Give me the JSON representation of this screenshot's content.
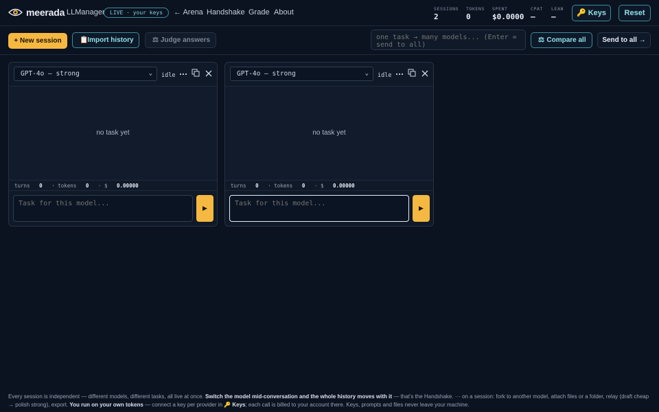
{
  "header": {
    "brand": "meerada",
    "app_name": "LLManager",
    "live_badge": "LIVE · your keys",
    "nav": [
      "← Arena",
      "Handshake",
      "Grade",
      "About"
    ],
    "stats": [
      {
        "label": "SESSIONS",
        "value": "2"
      },
      {
        "label": "TOKENS",
        "value": "0"
      },
      {
        "label": "SPENT",
        "value": "$0.0000"
      },
      {
        "label": "CPAT",
        "value": "—"
      },
      {
        "label": "LEAN",
        "value": "—"
      }
    ],
    "keys_label": "🔑 Keys",
    "reset_label": "Reset"
  },
  "toolbar": {
    "new_session": "+ New session",
    "import_history": "Import history",
    "judge_answers": "Judge answers",
    "broadcast_placeholder": "one task → many models... (Enter = send to all)",
    "compare_all": "Compare all",
    "send_to_all": "Send to all →"
  },
  "sessions": [
    {
      "model": "GPT-4o — strong",
      "state": "idle",
      "empty_text": "no task yet",
      "turns_label": "turns",
      "turns": "0",
      "tokens_label": "· tokens",
      "tokens": "0",
      "cost_label": "· $",
      "cost": "0.00000",
      "input_placeholder": "Task for this model...",
      "run_label": "▶"
    },
    {
      "model": "GPT-4o — strong",
      "state": "idle",
      "empty_text": "no task yet",
      "turns_label": "turns",
      "turns": "0",
      "tokens_label": "· tokens",
      "tokens": "0",
      "cost_label": "· $",
      "cost": "0.00000",
      "input_placeholder": "Task for this model...",
      "run_label": "▶"
    }
  ],
  "footer": {
    "p1": "Every session is independent — different models, different tasks, all live at once. ",
    "b1": "Switch the model mid-conversation and the whole history moves with it",
    "p2": " — that's the Handshake. ··· on a session: fork to another model, attach files or a folder, relay (draft cheap → polish strong), export. ",
    "b2": "You run on your own tokens",
    "p3": " — connect a key per provider in 🔑 ",
    "b3": "Keys",
    "p4": "; each call is billed to your account there. Keys, prompts and files never leave your machine."
  },
  "colors": {
    "background": "#0b1220",
    "accent_gold": "#f5b841",
    "accent_teal": "#3a8f9a"
  }
}
